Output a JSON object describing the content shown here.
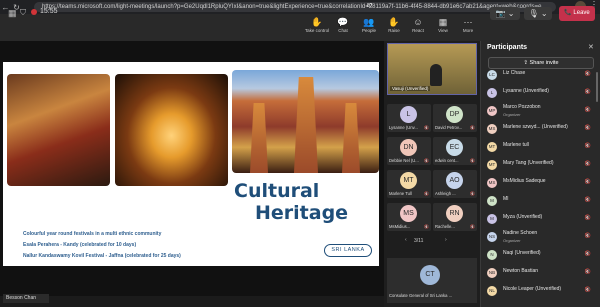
{
  "browser": {
    "url": "https://teams.microsoft.com/light-meetings/launch?p=Ge2Uqdl1RpluQYIxI&anon=true&lightExperience=true&correlationId=28119a7f-11b6-4f45-8844-db91e6c7ab21&agent=web&coords=e..."
  },
  "meeting": {
    "timer": "15:55",
    "toolbar": [
      {
        "key": "take-control",
        "label": "Take control",
        "icon": "✋"
      },
      {
        "key": "chat",
        "label": "Chat",
        "icon": "💬"
      },
      {
        "key": "people",
        "label": "People",
        "icon": "👥",
        "count": "87"
      },
      {
        "key": "raise",
        "label": "Raise",
        "icon": "✋"
      },
      {
        "key": "react",
        "label": "React",
        "icon": "☺"
      },
      {
        "key": "view",
        "label": "View",
        "icon": "▦"
      },
      {
        "key": "more",
        "label": "More",
        "icon": "⋯"
      }
    ],
    "leave_label": "Leave"
  },
  "slide": {
    "title_line1": "Cultural",
    "title_line2": "Heritage",
    "badge": "SRI LANKA",
    "lines": [
      "Colourful year round festivals in a multi ethnic community",
      "Esala Perahera - Kandy (celebrated for 10 days)",
      "Nallur Kandaswamy Kovil Festival - Jaffna (celebrated for 25 days)"
    ]
  },
  "presenter": {
    "name": "Besson Chan"
  },
  "gallery": {
    "self_name": "Vasuji (Unverified)",
    "tiles": [
      {
        "initials": "L",
        "name": "Lysanne (Unv...",
        "color": "#c9c3e6"
      },
      {
        "initials": "DP",
        "name": "David Petrov...",
        "color": "#cfe3c8"
      },
      {
        "initials": "DN",
        "name": "Debbie Nel (U...",
        "color": "#f0c6b8"
      },
      {
        "initials": "EC",
        "name": "edwin cent...",
        "color": "#c8dbe8"
      },
      {
        "initials": "MT",
        "name": "Marlene Tull",
        "color": "#f3d9a6"
      },
      {
        "initials": "AO",
        "name": "Ashleigh ...",
        "color": "#c6d4ec"
      },
      {
        "initials": "MS",
        "name": "MsMidius...",
        "color": "#f0c6c6"
      },
      {
        "initials": "RN",
        "name": "Rachelle...",
        "color": "#f0cfc0"
      }
    ],
    "page": "3/11",
    "featured": {
      "initials": "CT",
      "name": "Consulate General of Sri Lanka ..."
    }
  },
  "participants": {
    "title": "Participants",
    "share_label": "Share invite",
    "list": [
      {
        "initials": "LC",
        "name": "Liz Chase",
        "role": "",
        "color": "#c8dbe8"
      },
      {
        "initials": "L",
        "name": "Lysanne (Unverified)",
        "role": "",
        "color": "#c9c3e6"
      },
      {
        "initials": "MP",
        "name": "Marco Pozzobon",
        "role": "Organizer",
        "color": "#f0c6c6"
      },
      {
        "initials": "MS",
        "name": "Marlene szwyd... (Unverified)",
        "role": "",
        "color": "#f0cfc0"
      },
      {
        "initials": "MT",
        "name": "Marlene tull",
        "role": "",
        "color": "#f3d9a6"
      },
      {
        "initials": "MT",
        "name": "Mary Tang (Unverified)",
        "role": "",
        "color": "#f3d9a6"
      },
      {
        "initials": "MS",
        "name": "MsMidius Sadeque",
        "role": "",
        "color": "#f0c6c6"
      },
      {
        "initials": "M",
        "name": "MI",
        "role": "",
        "color": "#cfe3c8"
      },
      {
        "initials": "M",
        "name": "Myza (Unverified)",
        "role": "",
        "color": "#c9c3e6"
      },
      {
        "initials": "NS",
        "name": "Nadine Schoen",
        "role": "Organizer",
        "color": "#c6d4ec"
      },
      {
        "initials": "N",
        "name": "Naqi (Unverified)",
        "role": "",
        "color": "#cfe3c8"
      },
      {
        "initials": "NB",
        "name": "Newton Bastian",
        "role": "",
        "color": "#f0cfc0"
      },
      {
        "initials": "NL",
        "name": "Nicole Leaper (Unverified)",
        "role": "",
        "color": "#f3d9a6"
      }
    ]
  }
}
